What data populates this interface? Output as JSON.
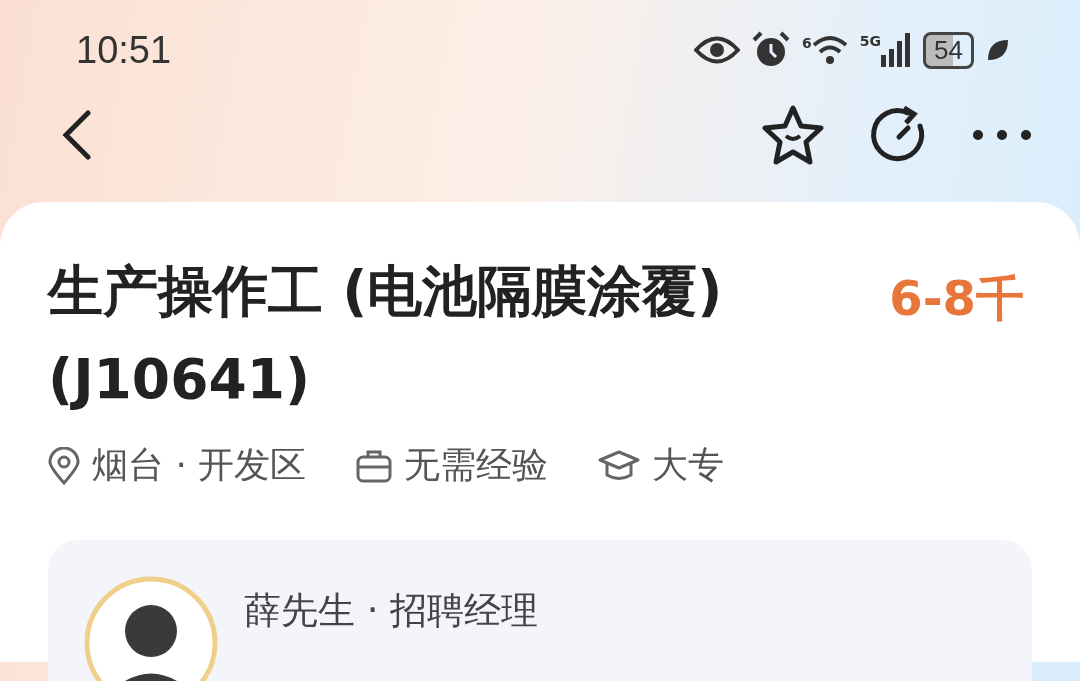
{
  "status_bar": {
    "time": "10:51",
    "wifi_label": "6",
    "network": "5G",
    "battery": "54"
  },
  "job": {
    "title": "生产操作工 (电池隔膜涂覆) (J10641)",
    "salary": "6-8千",
    "tags": [
      {
        "kind": "location",
        "text": "烟台 · 开发区"
      },
      {
        "kind": "experience",
        "text": "无需经验"
      },
      {
        "kind": "education",
        "text": "大专"
      }
    ]
  },
  "recruiter": {
    "name": "薛先生 · 招聘经理"
  }
}
